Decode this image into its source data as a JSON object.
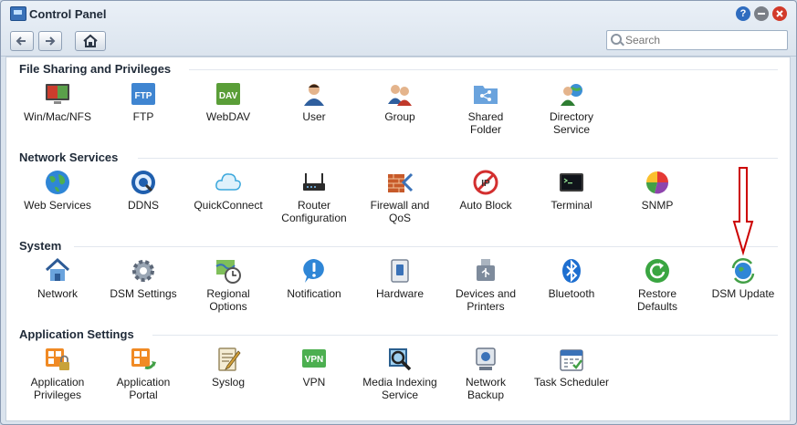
{
  "window": {
    "title": "Control Panel"
  },
  "toolbar": {
    "search_placeholder": "Search"
  },
  "sections": [
    {
      "title": "File Sharing and Privileges",
      "items": [
        "Win/Mac/NFS",
        "FTP",
        "WebDAV",
        "User",
        "Group",
        "Shared\nFolder",
        "Directory\nService"
      ]
    },
    {
      "title": "Network Services",
      "items": [
        "Web Services",
        "DDNS",
        "QuickConnect",
        "Router\nConfiguration",
        "Firewall and\nQoS",
        "Auto Block",
        "Terminal",
        "SNMP"
      ]
    },
    {
      "title": "System",
      "items": [
        "Network",
        "DSM Settings",
        "Regional\nOptions",
        "Notification",
        "Hardware",
        "Devices and\nPrinters",
        "Bluetooth",
        "Restore\nDefaults",
        "DSM Update"
      ]
    },
    {
      "title": "Application Settings",
      "items": [
        "Application\nPrivileges",
        "Application\nPortal",
        "Syslog",
        "VPN",
        "Media Indexing\nService",
        "Network\nBackup",
        "Task Scheduler"
      ]
    }
  ],
  "icon_text": {
    "ftp": "FTP",
    "dav": "DAV",
    "vpn": "VPN",
    "help": "?"
  },
  "colors": {
    "accent": "#3a72b8",
    "annotation": "#cc0000"
  }
}
